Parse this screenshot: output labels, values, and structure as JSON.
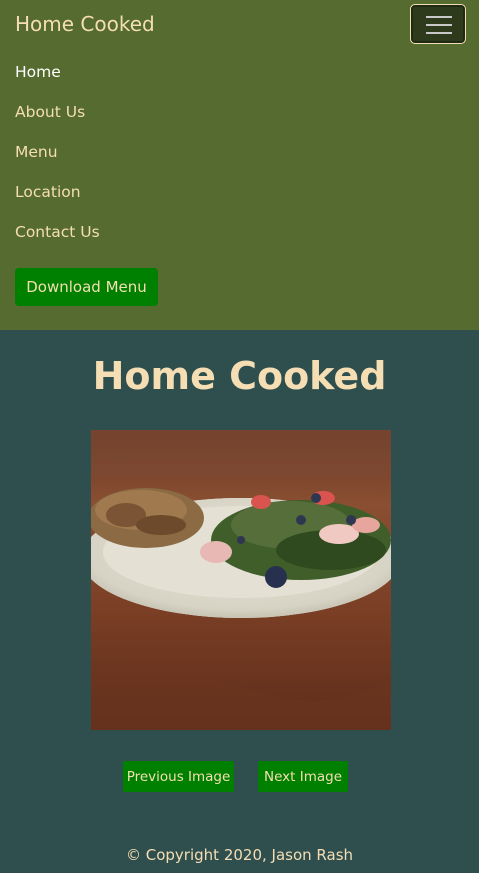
{
  "navbar": {
    "brand": "Home Cooked",
    "toggler_icon": "hamburger-menu-icon",
    "items": [
      {
        "label": "Home",
        "active": true
      },
      {
        "label": "About Us"
      },
      {
        "label": "Menu"
      },
      {
        "label": "Location"
      },
      {
        "label": "Contact Us"
      }
    ],
    "download_label": "Download Menu"
  },
  "main": {
    "title": "Home Cooked",
    "photo": {
      "subject": "plate with grilled meat and spinach strawberry salad"
    },
    "prev_label": "Previous Image",
    "next_label": "Next Image"
  },
  "footer": {
    "copyright": "© Copyright 2020, Jason Rash"
  },
  "colors": {
    "navbar_bg": "#556b2f",
    "page_bg": "#2f4f4f",
    "text_wheat": "#f5deb3",
    "button_green": "#008000"
  }
}
